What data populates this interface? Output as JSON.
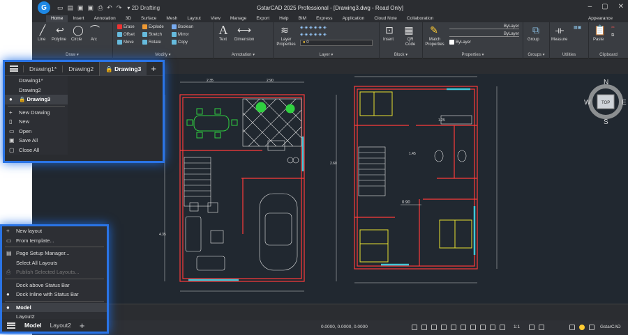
{
  "app": {
    "title": "GstarCAD 2025 Professional - [Drawing3.dwg - Read Only]",
    "logo": "G",
    "workspace": "2D Drafting",
    "appearance": "Appearance"
  },
  "menus": [
    "Home",
    "Insert",
    "Annotation",
    "3D",
    "Surface",
    "Mesh",
    "Layout",
    "View",
    "Manage",
    "Export",
    "Help",
    "BIM",
    "Express",
    "Application",
    "Cloud Note",
    "Collaboration"
  ],
  "ribbon": {
    "draw": {
      "title": "Draw",
      "tools": [
        "Line",
        "Polyline",
        "Circle",
        "Arc"
      ]
    },
    "modify": {
      "title": "Modify",
      "tools": [
        "Erase",
        "Explode",
        "Boolean",
        "Offset",
        "Stretch",
        "Mirror",
        "Move",
        "Rotate",
        "Copy"
      ]
    },
    "annotation": {
      "title": "Annotation",
      "tools": [
        "Text",
        "Dimension"
      ]
    },
    "layer": {
      "title": "Layer",
      "tools": [
        "Layer Properties"
      ],
      "current": "0"
    },
    "block": {
      "title": "Block",
      "tools": [
        "Insert",
        "QR Code"
      ]
    },
    "properties": {
      "title": "Properties",
      "tools": [
        "Match Properties"
      ],
      "values": [
        "ByLayer",
        "ByLayer",
        "ByLayer"
      ]
    },
    "groups": {
      "title": "Groups",
      "tools": [
        "Group"
      ]
    },
    "utilities": {
      "title": "Utilities",
      "tools": [
        "Measure"
      ]
    },
    "clipboard": {
      "title": "Clipboard",
      "tools": [
        "Paste"
      ]
    }
  },
  "doc_tabs": [
    "Drawing1*",
    "Drawing2",
    "Drawing3"
  ],
  "active_doc": "Drawing3",
  "doc_menu": {
    "documents": [
      "Drawing1*",
      "Drawing2",
      "Drawing3"
    ],
    "actions": [
      "New Drawing",
      "New",
      "Open",
      "Save All",
      "Close All"
    ]
  },
  "layout_menu": {
    "items": [
      "New layout",
      "From template...",
      "Page Setup Manager...",
      "Select All Layouts",
      "Publish Selected Layouts...",
      "Dock above Status Bar",
      "Dock Inline with Status Bar",
      "Model",
      "Layout2"
    ],
    "tabs": [
      "Model",
      "Layout2"
    ]
  },
  "viewcube": {
    "n": "N",
    "s": "S",
    "e": "E",
    "w": "W",
    "top": "TOP"
  },
  "dims": {
    "d1": "0.90",
    "d2": "2.35",
    "d3": "2.90",
    "d4": "1.45",
    "d5": "2.60",
    "d6": "1.25",
    "d7": "4.35"
  },
  "status": {
    "coords": "0.0000, 0.0000, 0.0000",
    "scale": "1:1",
    "user": "GstarCAD"
  },
  "colors": {
    "accent": "#2a74e6",
    "drawing_bg": "#212830",
    "wall": "#ff3b3b",
    "furniture": "#e6e6e6",
    "yellow": "#e8e030",
    "green": "#30d040",
    "cyan": "#40c8d8"
  }
}
